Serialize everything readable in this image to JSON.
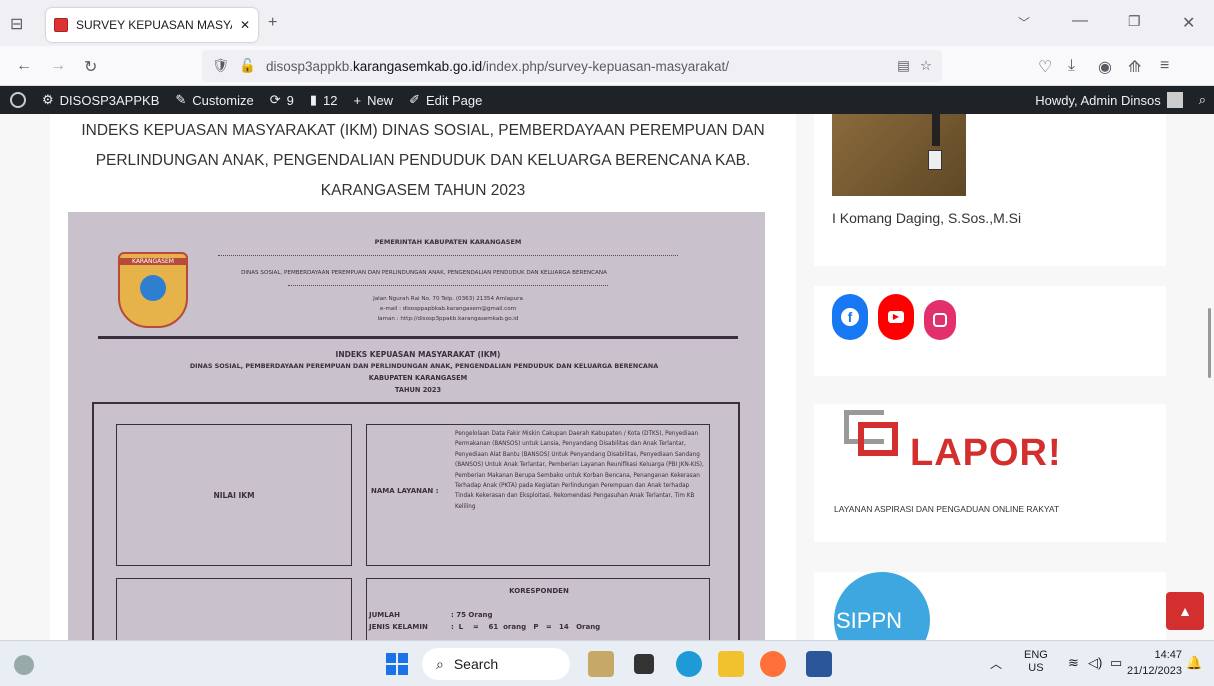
{
  "browser": {
    "tab_title": "SURVEY KEPUASAN MASYARAK",
    "url_prefix": "disosp3appkb.",
    "url_domain": "karangasemkab.go.id",
    "url_path": "/index.php/survey-kepuasan-masyarakat/"
  },
  "wpbar": {
    "site": "DISOSP3APPKB",
    "customize": "Customize",
    "updates": "9",
    "comments": "12",
    "new": "New",
    "edit": "Edit Page",
    "howdy": "Howdy, Admin Dinsos"
  },
  "page": {
    "heading": "INDEKS KEPUASAN MASYARAKAT (IKM) DINAS SOSIAL, PEMBERDAYAAN PEREMPUAN DAN PERLINDUNGAN ANAK, PENGENDALIAN PENDUDUK DAN KELUARGA BERENCANA KAB. KARANGASEM TAHUN 2023"
  },
  "document": {
    "gov": "PEMERINTAH KABUPATEN KARANGASEM",
    "dept": "DINAS SOSIAL, PEMBERDAYAAN PEREMPUAN DAN PERLINDUNGAN ANAK, PENGENDALIAN PENDUDUK DAN KELUARGA BERENCANA",
    "addr1": "Jalan Ngurah Rai No. 70 Telp. (0363) 21354 Amlapura",
    "addr2": "e-mail : disosppapbkab.karangasem@gmail.com",
    "addr3": "laman : http://disosp3ppakb.karangasemkab.go.id",
    "logo_text": "KARANGASEM",
    "title1": "INDEKS KEPUASAN MASYARAKAT (IKM)",
    "title2": "DINAS SOSIAL, PEMBERDAYAAN PEREMPUAN DAN PERLINDUNGAN ANAK, PENGENDALIAN PENDUDUK DAN KELUARGA BERENCANA",
    "title3": "KABUPATEN KARANGASEM",
    "title4": "TAHUN 2023",
    "nilai_label": "NILAI IKM",
    "layanan_label": "NAMA LAYANAN :",
    "layanan_text": "Pengelolaan Data Fakir Miskin Cakupan Daerah Kabupaten / Kota (DTKS), Penyediaan Permakanan (BANSOS) untuk Lansia, Penyandang Disabilitas dan Anak Terlantar, Penyediaan Alat Bantu (BANSOS) Untuk Penyandang Disabilitas, Penyediaan Sandang (BANSOS) Untuk Anak Terlantar, Pemberian Layanan Reunifikasi Keluarga (PBI JKN-KIS), Pemberian Makanan Berupa Sembako untuk Korban Bencana, Penanganan Kekerasan Terhadap Anak (PKTA) pada Kegiatan Perlindungan Perempuan dan Anak terhadap Tindak Kekerasan dan Eksploitasi, Rekomendasi Pengasuhan Anak Terlantar, Tim KB Keliling",
    "responden": "KORESPONDEN",
    "jumlah_label": "JUMLAH",
    "jumlah_val": ": 75 Orang",
    "jk_label": "JENIS KELAMIN",
    "jk_val": ":  L    =    61  orang   P   =   14   Orang"
  },
  "sidebar": {
    "official_name": "I Komang Daging, S.Sos.,M.Si",
    "lapor_big": "LAPOR!",
    "lapor_sub": "LAYANAN ASPIRASI DAN PENGADUAN ONLINE RAKYAT",
    "sippn": "SIPPN"
  },
  "taskbar": {
    "search": "Search",
    "lang1": "ENG",
    "lang2": "US",
    "time": "14:47",
    "date": "21/12/2023"
  },
  "colors": {
    "accent": "#d32f2f",
    "wp": "#1d2327",
    "facebook": "#1877f2",
    "youtube": "#ff0000",
    "instagram": "#e1306c"
  }
}
